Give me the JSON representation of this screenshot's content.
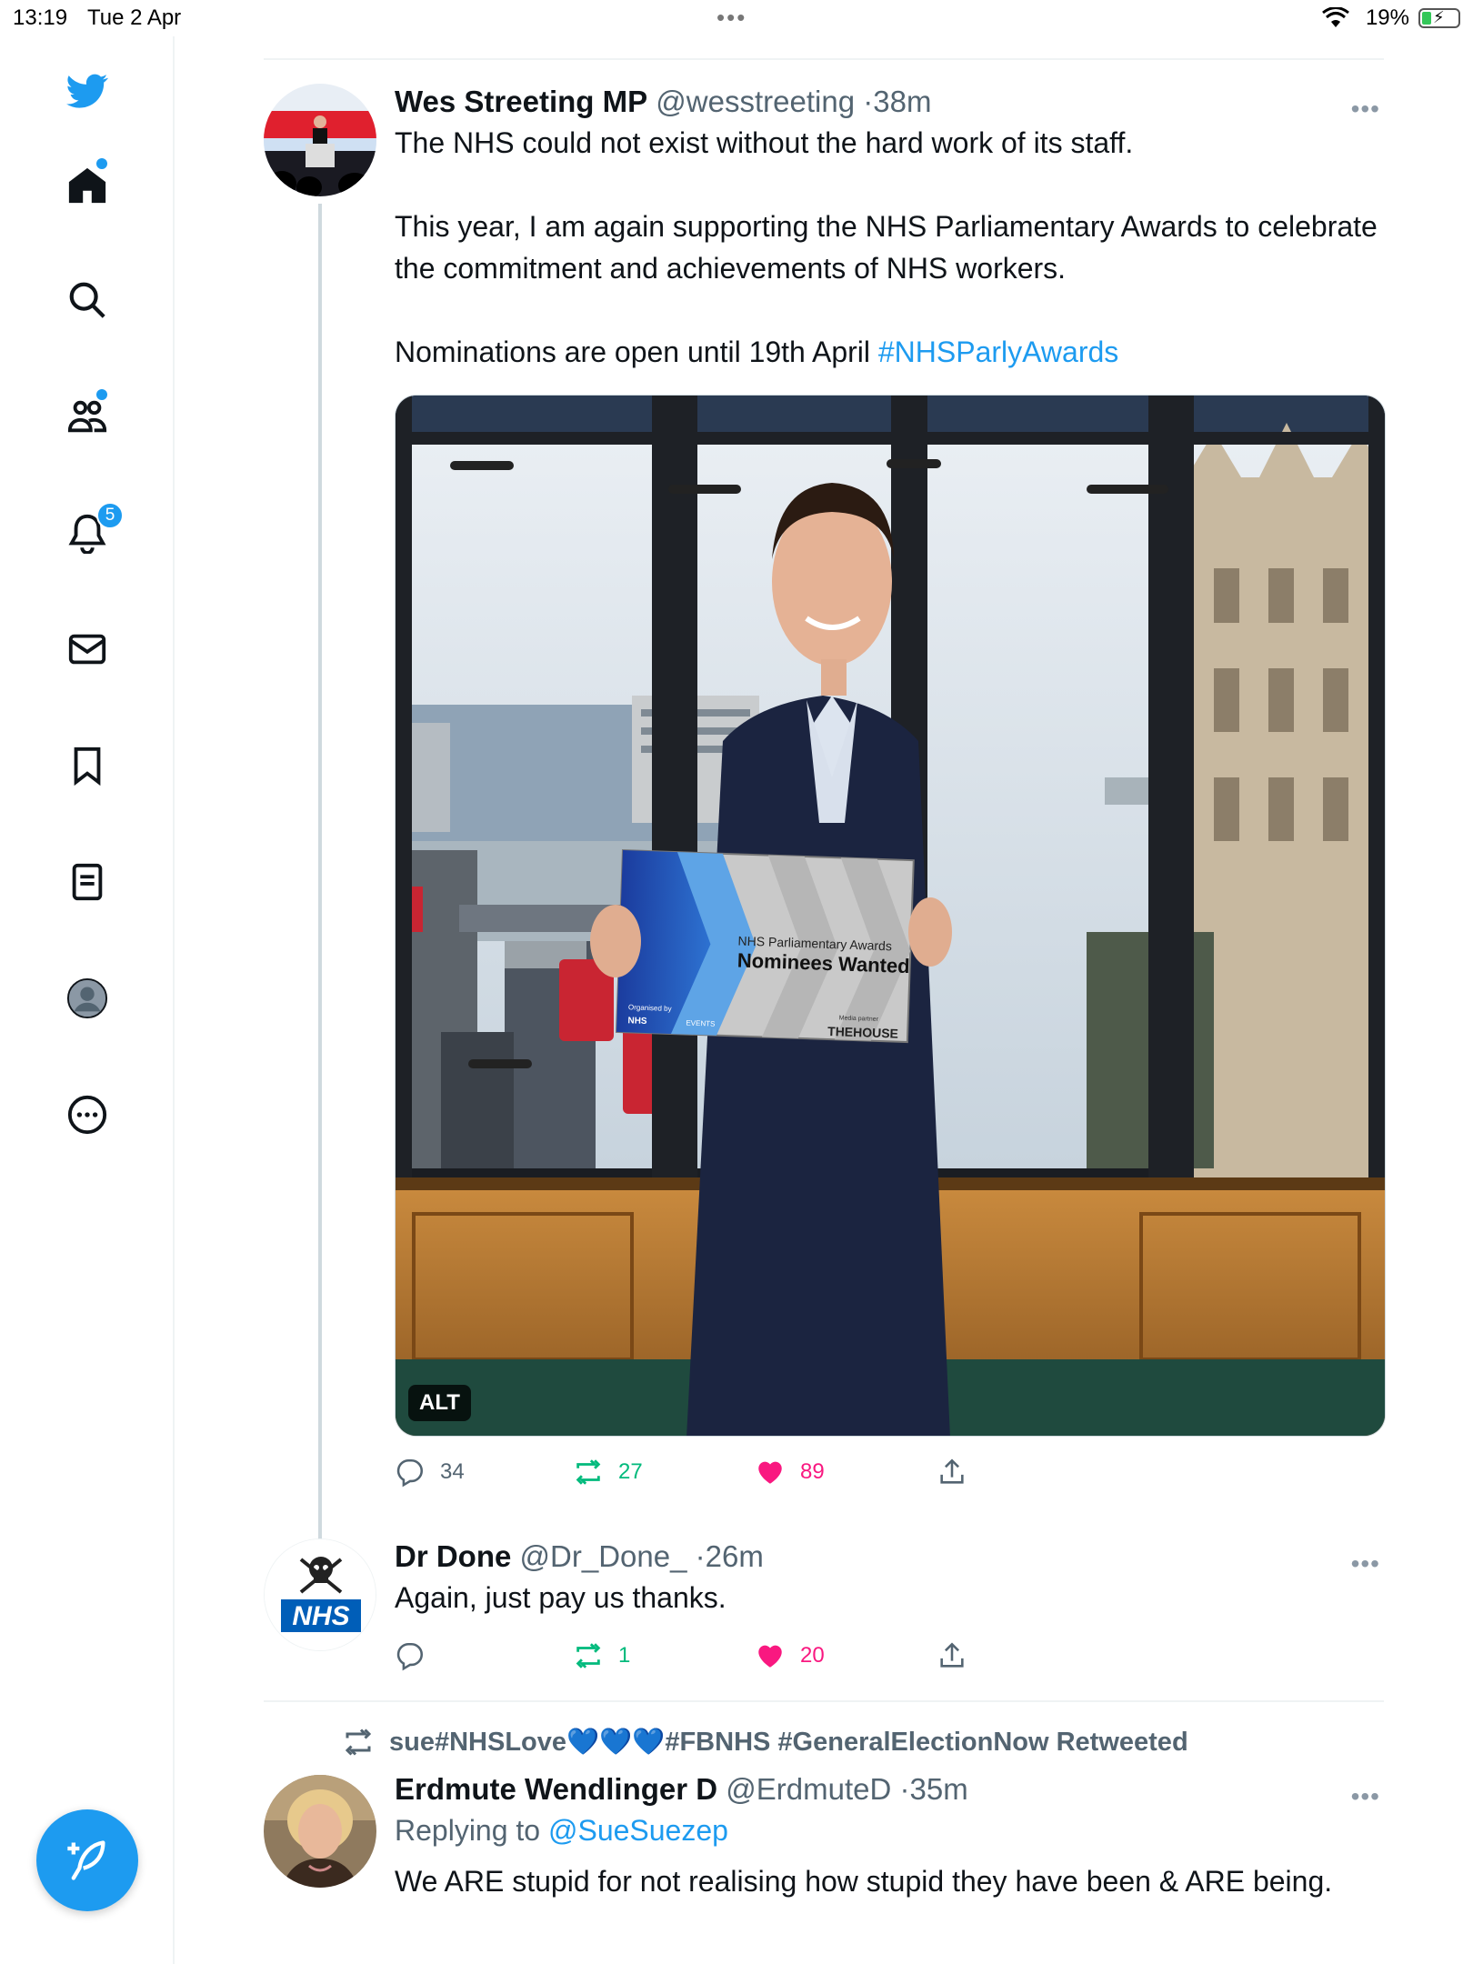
{
  "status_bar": {
    "time": "13:19",
    "date": "Tue 2 Apr",
    "battery": "19%"
  },
  "sidebar": {
    "items": [
      {
        "icon": "twitter-bird-icon"
      },
      {
        "icon": "home-icon"
      },
      {
        "icon": "search-icon"
      },
      {
        "icon": "communities-icon"
      },
      {
        "icon": "bell-icon",
        "badge": "5"
      },
      {
        "icon": "mail-icon"
      },
      {
        "icon": "bookmark-icon"
      },
      {
        "icon": "lists-icon"
      },
      {
        "icon": "profile-icon"
      },
      {
        "icon": "more-circle-icon"
      }
    ],
    "compose_icon": "compose-tweet-icon"
  },
  "tweets": [
    {
      "name": "Wes Streeting MP",
      "handle": "@wesstreeting",
      "sep": "·",
      "time": "38m",
      "text": {
        "p1": "The NHS could not exist without the hard work of its staff.",
        "p2": "This year, I am again supporting the NHS Parliamentary Awards to celebrate the commitment and achievements of NHS workers.",
        "p3_prefix": "Nominations are open until 19th April ",
        "p3_hashtag": "#NHSParlyAwards"
      },
      "media": {
        "alt_label": "ALT",
        "sign_line1": "NHS Parliamentary Awards",
        "sign_line2": "Nominees Wanted",
        "sign_partner_label": "Media partner",
        "sign_partner": "THEHOUSE",
        "sign_org_label": "Organised by",
        "sign_nhs": "NHS",
        "sign_events": "EVENTS"
      },
      "replies": "34",
      "retweets": "27",
      "likes": "89"
    },
    {
      "name": "Dr Done",
      "handle": "@Dr_Done_",
      "sep": "·",
      "time": "26m",
      "avatar_text": "NHS",
      "text": "Again, just pay us thanks.",
      "replies": "",
      "retweets": "1",
      "likes": "20"
    },
    {
      "retweeted_by": "sue#NHSLove💙💙💙#FBNHS #GeneralElectionNow Retweeted",
      "name": "Erdmute Wendlinger D",
      "handle": "@ErdmuteD",
      "sep": "·",
      "time": "35m",
      "replying_prefix": "Replying to ",
      "replying_to": "@SueSuezep",
      "text": "We ARE stupid for not realising how stupid they have been & ARE being."
    }
  ],
  "colors": {
    "accent": "#1d9bf0",
    "retweet_green": "#00ba7c",
    "like_pink": "#f91880",
    "secondary_text": "#536471"
  }
}
